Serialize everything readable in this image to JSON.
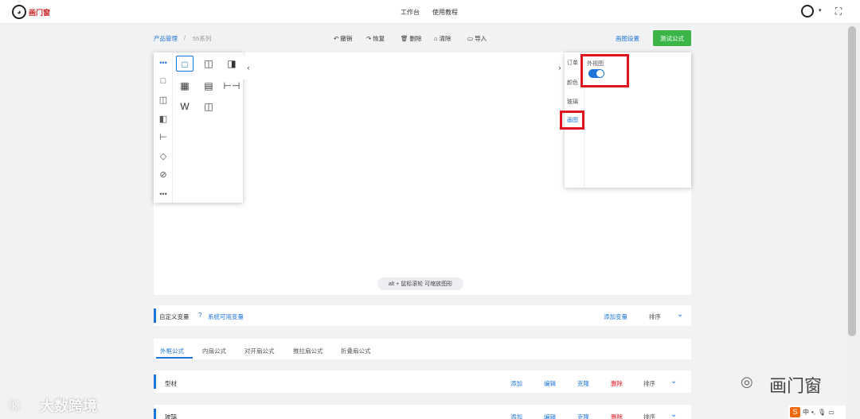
{
  "topbar": {
    "logo_text": "画门窗",
    "nav": [
      "工作台",
      "使用教程"
    ],
    "caret": "▾",
    "fullscreen_icon": "⛶"
  },
  "breadcrumb": {
    "root": "产品管理",
    "sep": "/",
    "current": "55系列"
  },
  "toolbar": {
    "undo": "撤销",
    "redo": "恢复",
    "delete": "删除",
    "clear": "清除",
    "import": "导入",
    "drawing_settings": "画图设置",
    "test_formula": "测试公式"
  },
  "canvas": {
    "hint": "alt + 鼠标滚轮 可缩放图形"
  },
  "palette": {
    "more_icon": "•••",
    "bottom_more_icon": "•••",
    "tools_row1": [
      "□",
      "◫",
      "◨"
    ],
    "tools_row2": [
      "▦",
      "▤",
      "⊢⊣"
    ],
    "tools_row3": [
      "W",
      "◫"
    ]
  },
  "right_panel": {
    "tabs": [
      "订单",
      "颜色",
      "玻璃",
      "画图"
    ],
    "field_label": "外视图",
    "toggle_on": true
  },
  "variables": {
    "title": "自定义变量",
    "system_vars": "系统可用变量",
    "add": "添加变量",
    "sort": "排序"
  },
  "formula_tabs": [
    "外框公式",
    "内扇公式",
    "对开扇公式",
    "推拉扇公式",
    "折叠扇公式"
  ],
  "sections": [
    {
      "name": "型材",
      "add": "添加",
      "edit": "编辑",
      "clone": "克隆",
      "delete": "删除",
      "sort": "排序"
    },
    {
      "name": "玻璃",
      "add": "添加",
      "edit": "编辑",
      "clone": "克隆",
      "delete": "删除",
      "sort": "排序"
    }
  ],
  "watermarks": {
    "left": "大数跨境",
    "right": "画门窗"
  },
  "taskbar": {
    "ime": "S",
    "lang": "中"
  },
  "colors": {
    "accent": "#1e74d8",
    "green": "#3bb54a",
    "danger": "#e0141e"
  }
}
